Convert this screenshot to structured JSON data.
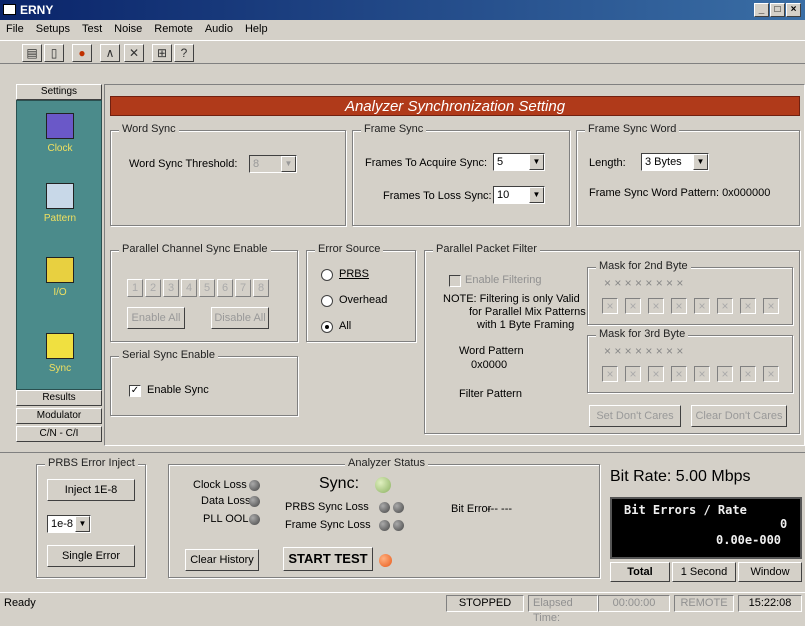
{
  "window": {
    "title": "ERNY"
  },
  "menu": [
    "File",
    "Setups",
    "Test",
    "Noise",
    "Remote",
    "Audio",
    "Help"
  ],
  "sidebar": {
    "top_tab": "Settings",
    "items": [
      "Clock",
      "Pattern",
      "I/O",
      "Sync"
    ],
    "bottom_tabs": [
      "Results",
      "Modulator",
      "C/N - C/I"
    ]
  },
  "banner": "Analyzer Synchronization Setting",
  "word_sync": {
    "legend": "Word Sync",
    "threshold_label": "Word Sync Threshold:",
    "threshold_value": "8"
  },
  "frame_sync": {
    "legend": "Frame Sync",
    "acquire_label": "Frames To Acquire Sync:",
    "acquire_value": "5",
    "loss_label": "Frames To Loss Sync:",
    "loss_value": "10"
  },
  "frame_sync_word": {
    "legend": "Frame Sync Word",
    "length_label": "Length:",
    "length_value": "3 Bytes",
    "pattern_text": "Frame Sync Word Pattern: 0x000000"
  },
  "parallel_channel": {
    "legend": "Parallel Channel Sync Enable",
    "channels": [
      "1",
      "2",
      "3",
      "4",
      "5",
      "6",
      "7",
      "8"
    ],
    "enable_all": "Enable All",
    "disable_all": "Disable All"
  },
  "error_source": {
    "legend": "Error Source",
    "options": [
      "PRBS",
      "Overhead",
      "All"
    ],
    "selected": "All"
  },
  "packet_filter": {
    "legend": "Parallel Packet Filter",
    "enable_label": "Enable Filtering",
    "note": [
      "NOTE:  Filtering is only Valid",
      "for Parallel Mix Patterns",
      "with 1 Byte Framing"
    ],
    "word_pattern_label": "Word Pattern",
    "word_pattern_value": "0x0000",
    "filter_pattern_label": "Filter Pattern",
    "mask2_legend": "Mask for 2nd Byte",
    "mask3_legend": "Mask for 3rd Byte",
    "set_dont_cares": "Set Don't Cares",
    "clear_dont_cares": "Clear Don't Cares"
  },
  "serial_sync": {
    "legend": "Serial Sync Enable",
    "enable_label": "Enable Sync",
    "checked": true
  },
  "prbs_inject": {
    "legend": "PRBS Error Inject",
    "inject_button": "Inject 1E-8",
    "rate_value": "1e-8",
    "single_error": "Single Error"
  },
  "analyzer_status": {
    "legend": "Analyzer Status",
    "clock_loss": "Clock Loss",
    "data_loss": "Data Loss",
    "pll_ool": "PLL OOL",
    "sync_label": "Sync:",
    "prbs_sync_loss": "PRBS Sync Loss",
    "frame_sync_loss": "Frame Sync Loss",
    "bit_error_label": "Bit Error",
    "bit_error_value": "---  ---",
    "clear_history": "Clear History",
    "start_test": "START TEST"
  },
  "bit_rate": "Bit Rate: 5.00 Mbps",
  "lcd": {
    "header": "Bit Errors / Rate",
    "count": "0",
    "rate": "0.00e-000"
  },
  "result_tabs": [
    "Total",
    "1 Second",
    "Window"
  ],
  "statusbar": {
    "left": "Ready",
    "state": "STOPPED",
    "elapsed_label": "Elapsed Time:",
    "elapsed_value": "00:00:00",
    "remote": "REMOTE",
    "clock": "15:22:08"
  },
  "colors": {
    "banner": "#b03a1a",
    "sidebar": "#4b8b8b",
    "start_led": "#e85a1a",
    "sync_led": "#b8d890"
  }
}
